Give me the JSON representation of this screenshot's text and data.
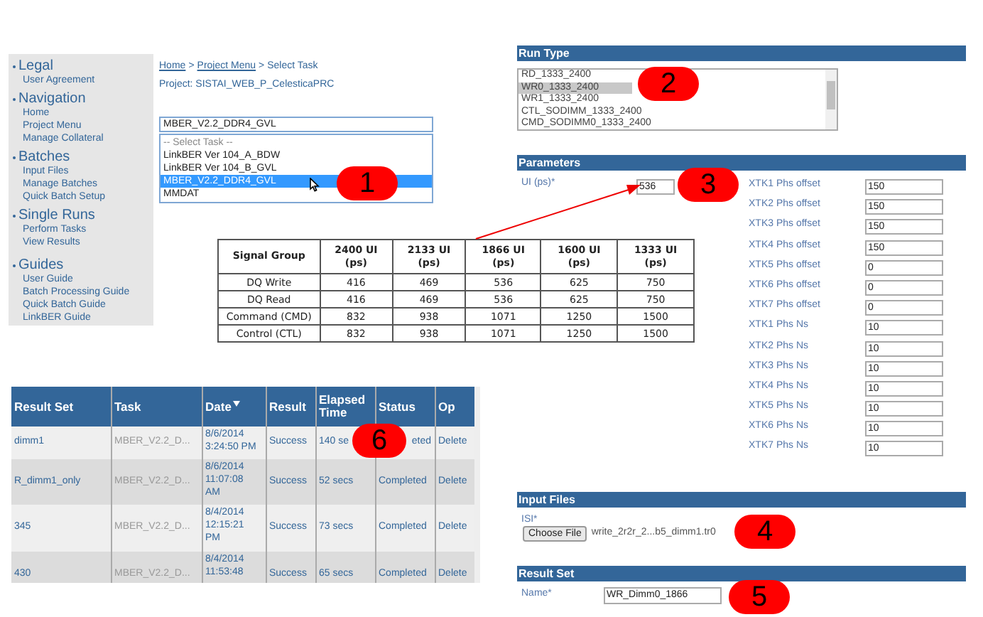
{
  "sidebar": {
    "sections": [
      {
        "title": "Legal",
        "items": [
          "User Agreement"
        ]
      },
      {
        "title": "Navigation",
        "items": [
          "Home",
          "Project Menu",
          "Manage Collateral"
        ]
      },
      {
        "title": "Batches",
        "items": [
          "Input Files",
          "Manage Batches",
          "Quick Batch Setup"
        ]
      },
      {
        "title": "Single Runs",
        "items": [
          "Perform Tasks",
          "View Results"
        ]
      },
      {
        "title": "Guides",
        "items": [
          "User Guide",
          "Batch Processing Guide",
          "Quick Batch Guide",
          "LinkBER Guide"
        ]
      }
    ]
  },
  "breadcrumb": {
    "separator": ">",
    "items": [
      {
        "label": "Home",
        "link": true
      },
      {
        "label": "Project Menu",
        "link": true
      },
      {
        "label": "Select Task",
        "link": false
      }
    ]
  },
  "project": "Project: SISTAI_WEB_P_CelesticaPRC",
  "task_select": {
    "value": "MBER_V2.2_DDR4_GVL",
    "options": [
      {
        "label": "-- Select Task --",
        "selected": false
      },
      {
        "label": "LinkBER Ver 104_A_BDW",
        "selected": false
      },
      {
        "label": "LinkBER Ver 104_B_GVL",
        "selected": false
      },
      {
        "label": "MBER_V2.2_DDR4_GVL",
        "selected": true
      },
      {
        "label": "MMDAT",
        "selected": false
      }
    ]
  },
  "signal_table": {
    "columns": [
      "Signal Group",
      "2400 UI (ps)",
      "2133 UI (ps)",
      "1866 UI (ps)",
      "1600 UI (ps)",
      "1333 UI (ps)"
    ],
    "rows": [
      [
        "DQ Write",
        "416",
        "469",
        "536",
        "625",
        "750"
      ],
      [
        "DQ Read",
        "416",
        "469",
        "536",
        "625",
        "750"
      ],
      [
        "Command (CMD)",
        "832",
        "938",
        "1071",
        "1250",
        "1500"
      ],
      [
        "Control (CTL)",
        "832",
        "938",
        "1071",
        "1250",
        "1500"
      ]
    ]
  },
  "run_type": {
    "title": "Run Type",
    "options": [
      {
        "label": "RD_1333_2400",
        "selected": false
      },
      {
        "label": "WR0_1333_2400",
        "selected": true
      },
      {
        "label": "WR1_1333_2400",
        "selected": false
      },
      {
        "label": "CTL_SODIMM_1333_2400",
        "selected": false
      },
      {
        "label": "CMD_SODIMM0_1333_2400",
        "selected": false
      }
    ]
  },
  "parameters": {
    "title": "Parameters",
    "ui": {
      "label": "UI (ps)*",
      "value": "536"
    },
    "fields": [
      {
        "label": "XTK1 Phs offset",
        "value": "150"
      },
      {
        "label": "XTK2 Phs offset",
        "value": "150"
      },
      {
        "label": "XTK3 Phs offset",
        "value": "150"
      },
      {
        "label": "XTK4 Phs offset",
        "value": "150"
      },
      {
        "label": "XTK5 Phs offset",
        "value": "0"
      },
      {
        "label": "XTK6 Phs offset",
        "value": "0"
      },
      {
        "label": "XTK7 Phs offset",
        "value": "0"
      },
      {
        "label": "XTK1 Phs Ns",
        "value": "10"
      },
      {
        "label": "XTK2 Phs Ns",
        "value": "10"
      },
      {
        "label": "XTK3 Phs Ns",
        "value": "10"
      },
      {
        "label": "XTK4 Phs Ns",
        "value": "10"
      },
      {
        "label": "XTK5 Phs Ns",
        "value": "10"
      },
      {
        "label": "XTK6 Phs Ns",
        "value": "10"
      },
      {
        "label": "XTK7 Phs Ns",
        "value": "10"
      }
    ]
  },
  "input_files": {
    "title": "Input Files",
    "label": "ISI*",
    "button": "Choose File",
    "file_name": "write_2r2r_2...b5_dimm1.tr0"
  },
  "result_set": {
    "title": "Result Set",
    "label": "Name*",
    "value": "WR_Dimm0_1866"
  },
  "results_table": {
    "columns": [
      {
        "label": "Result Set",
        "sorted": false
      },
      {
        "label": "Task",
        "sorted": false
      },
      {
        "label": "Date",
        "sorted": true
      },
      {
        "label": "Result",
        "sorted": false
      },
      {
        "label": "Elapsed Time",
        "sorted": false
      },
      {
        "label": "Status",
        "sorted": false
      },
      {
        "label": "Op",
        "sorted": false
      }
    ],
    "rows": [
      [
        "dimm1",
        "MBER_V2.2_D...",
        "8/6/2014\n3:24:50 PM",
        "Success",
        "140 se",
        "eted",
        "Delete"
      ],
      [
        "R_dimm1_only",
        "MBER_V2.2_D...",
        "8/6/2014\n11:07:08\nAM",
        "Success",
        "52 secs",
        "Completed",
        "Delete"
      ],
      [
        "345",
        "MBER_V2.2_D...",
        "8/4/2014\n12:15:21\nPM",
        "Success",
        "73 secs",
        "Completed",
        "Delete"
      ],
      [
        "430",
        "MBER_V2.2_D...",
        "8/4/2014\n11:53:48",
        "Success",
        "65 secs",
        "Completed",
        "Delete"
      ]
    ]
  },
  "callouts": [
    "1",
    "2",
    "3",
    "4",
    "5",
    "6"
  ]
}
